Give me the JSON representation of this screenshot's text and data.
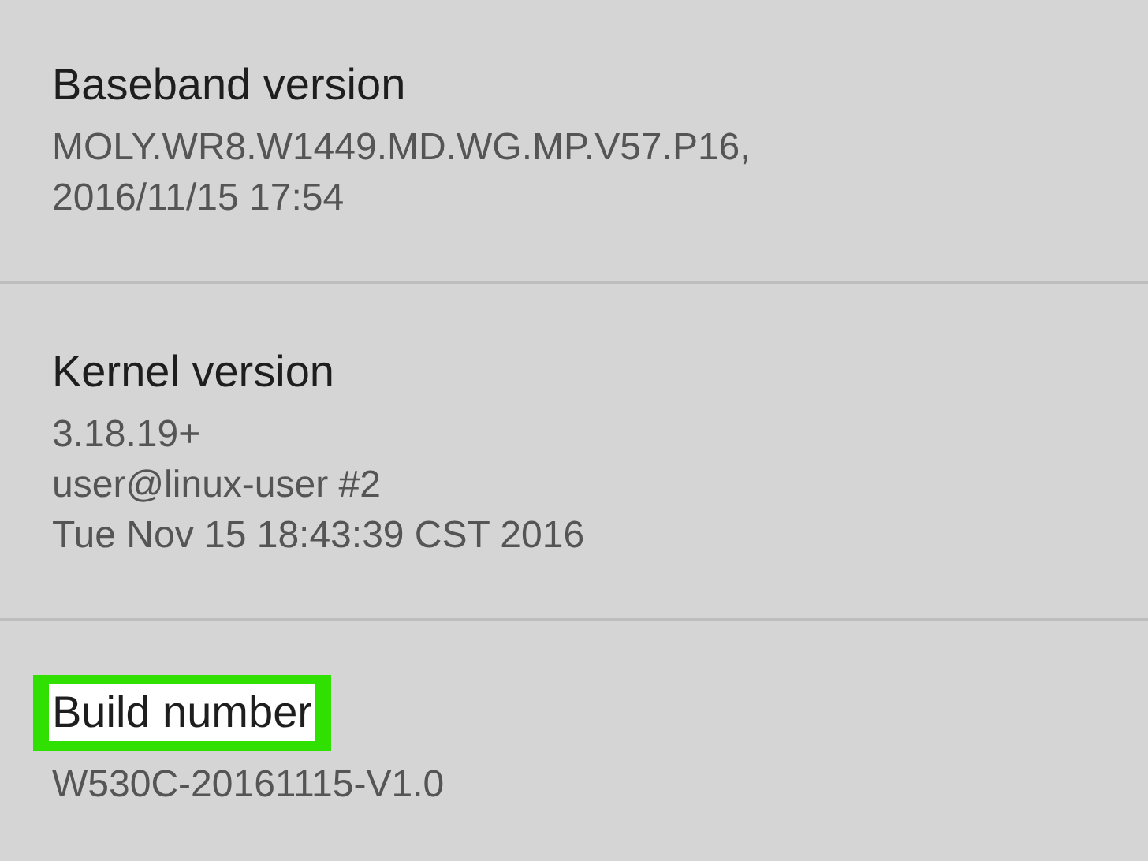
{
  "items": [
    {
      "title": "Baseband version",
      "highlighted": false,
      "lines": [
        "MOLY.WR8.W1449.MD.WG.MP.V57.P16,",
        "2016/11/15 17:54"
      ]
    },
    {
      "title": "Kernel version",
      "highlighted": false,
      "lines": [
        "3.18.19+",
        "user@linux-user #2",
        "Tue Nov 15 18:43:39 CST 2016"
      ]
    },
    {
      "title": "Build number",
      "highlighted": true,
      "lines": [
        "W530C-20161115-V1.0"
      ]
    }
  ]
}
